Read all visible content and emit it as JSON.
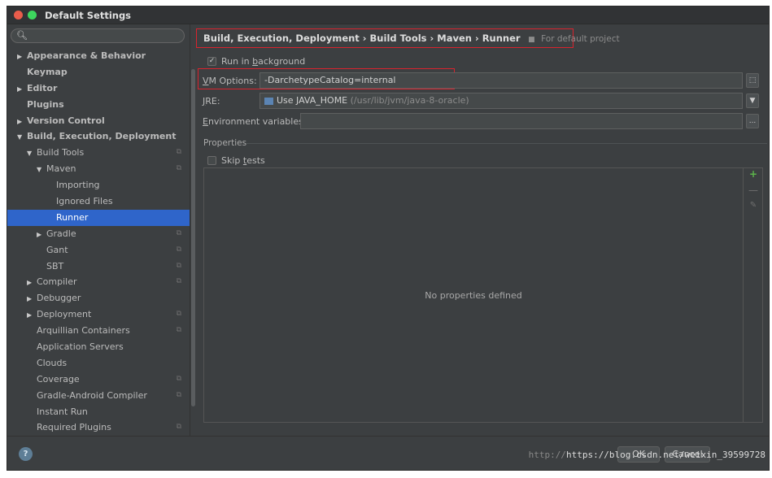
{
  "window": {
    "title": "Default Settings"
  },
  "sidebar": {
    "search_icon": "search-icon",
    "items": [
      {
        "label": "Appearance & Behavior",
        "arrow": "▶",
        "indent": 0,
        "bold": true
      },
      {
        "label": "Keymap",
        "arrow": "",
        "indent": 0,
        "bold": true
      },
      {
        "label": "Editor",
        "arrow": "▶",
        "indent": 0,
        "bold": true
      },
      {
        "label": "Plugins",
        "arrow": "",
        "indent": 0,
        "bold": true
      },
      {
        "label": "Version Control",
        "arrow": "▶",
        "indent": 0,
        "bold": true
      },
      {
        "label": "Build, Execution, Deployment",
        "arrow": "▼",
        "indent": 0,
        "bold": true
      },
      {
        "label": "Build Tools",
        "arrow": "▼",
        "indent": 1,
        "proj": true
      },
      {
        "label": "Maven",
        "arrow": "▼",
        "indent": 2,
        "proj": true
      },
      {
        "label": "Importing",
        "arrow": "",
        "indent": 3
      },
      {
        "label": "Ignored Files",
        "arrow": "",
        "indent": 3
      },
      {
        "label": "Runner",
        "arrow": "",
        "indent": 3,
        "selected": true
      },
      {
        "label": "Gradle",
        "arrow": "▶",
        "indent": 2,
        "proj": true
      },
      {
        "label": "Gant",
        "arrow": "",
        "indent": 2,
        "proj": true
      },
      {
        "label": "SBT",
        "arrow": "",
        "indent": 2,
        "proj": true
      },
      {
        "label": "Compiler",
        "arrow": "▶",
        "indent": 1,
        "proj": true
      },
      {
        "label": "Debugger",
        "arrow": "▶",
        "indent": 1
      },
      {
        "label": "Deployment",
        "arrow": "▶",
        "indent": 1,
        "proj": true
      },
      {
        "label": "Arquillian Containers",
        "arrow": "",
        "indent": 1,
        "proj": true
      },
      {
        "label": "Application Servers",
        "arrow": "",
        "indent": 1
      },
      {
        "label": "Clouds",
        "arrow": "",
        "indent": 1
      },
      {
        "label": "Coverage",
        "arrow": "",
        "indent": 1,
        "proj": true
      },
      {
        "label": "Gradle-Android Compiler",
        "arrow": "",
        "indent": 1,
        "proj": true
      },
      {
        "label": "Instant Run",
        "arrow": "",
        "indent": 1
      },
      {
        "label": "Required Plugins",
        "arrow": "",
        "indent": 1,
        "proj": true
      }
    ]
  },
  "main": {
    "breadcrumb": "Build, Execution, Deployment › Build Tools › Maven › Runner",
    "breadcrumb_note": "For default project",
    "run_in_background": {
      "pre": "Run in ",
      "u": "b",
      "post": "ackground",
      "checked": true
    },
    "vm_options": {
      "label_u": "V",
      "label_rest": "M Options:",
      "value": "-DarchetypeCatalog=internal"
    },
    "jre": {
      "label_u": "J",
      "label_rest": "RE:",
      "value": "Use JAVA_HOME",
      "path": "(/usr/lib/jvm/java-8-oracle)"
    },
    "env": {
      "label_u": "E",
      "label_rest": "nvironment variables:",
      "value": "",
      "button": "..."
    },
    "properties_title": "Properties",
    "skip_tests": {
      "pre": "Skip ",
      "u": "t",
      "post": "ests",
      "checked": false
    },
    "no_properties": "No properties defined",
    "tools": {
      "add": "+",
      "remove": "—",
      "edit": "✎"
    }
  },
  "footer": {
    "help": "?",
    "watermark_dim": "http://",
    "watermark": "https://blog.csdn.net/weixin_39599728",
    "ok": "OK",
    "cancel": "Cancel"
  }
}
